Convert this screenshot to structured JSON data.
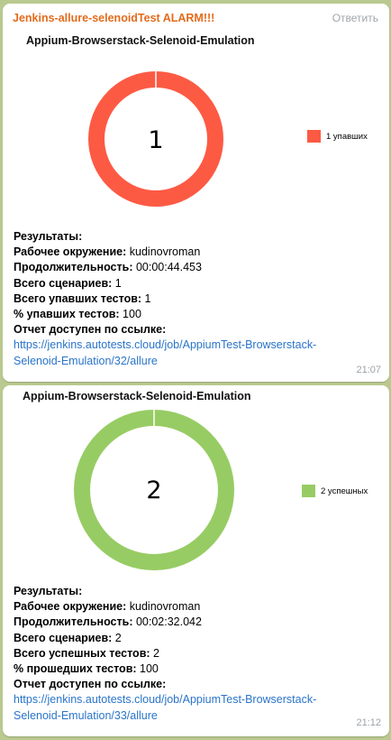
{
  "header": {
    "sender": "Jenkins-allure-selenoidTest ALARM!!!",
    "reply_label": "Ответить"
  },
  "messages": [
    {
      "chart_title": "Appium-Browserstack-Selenoid-Emulation",
      "center_label": "1",
      "legend_label": "1 упавших",
      "color": "#fd5a44",
      "results": {
        "heading": "Результаты:",
        "env_label": "Рабочее окружение:",
        "env_value": "kudinovroman",
        "dur_label": "Продолжительность:",
        "dur_value": "00:00:44.453",
        "total_label": "Всего сценариев:",
        "total_value": "1",
        "count_label": "Всего упавших тестов:",
        "count_value": "1",
        "pct_label": "% упавших тестов:",
        "pct_value": "100",
        "link_label": "Отчет доступен по ссылке:",
        "link_line1": "https://jenkins.autotests.cloud/job/AppiumTest-Browserstack-",
        "link_line2": "Selenoid-Emulation/32/allure"
      },
      "time": "21:07"
    },
    {
      "chart_title": "Appium-Browserstack-Selenoid-Emulation",
      "center_label": "2",
      "legend_label": "2 успешных",
      "color": "#97cc64",
      "results": {
        "heading": "Результаты:",
        "env_label": "Рабочее окружение:",
        "env_value": "kudinovroman",
        "dur_label": "Продолжительность:",
        "dur_value": "00:02:32.042",
        "total_label": "Всего сценариев:",
        "total_value": "2",
        "count_label": "Всего успешных тестов:",
        "count_value": "2",
        "pct_label": "% прошедших тестов:",
        "pct_value": "100",
        "link_label": "Отчет доступен по ссылке:",
        "link_line1": "https://jenkins.autotests.cloud/job/AppiumTest-Browserstack-",
        "link_line2": "Selenoid-Emulation/33/allure"
      },
      "time": "21:12"
    }
  ]
}
